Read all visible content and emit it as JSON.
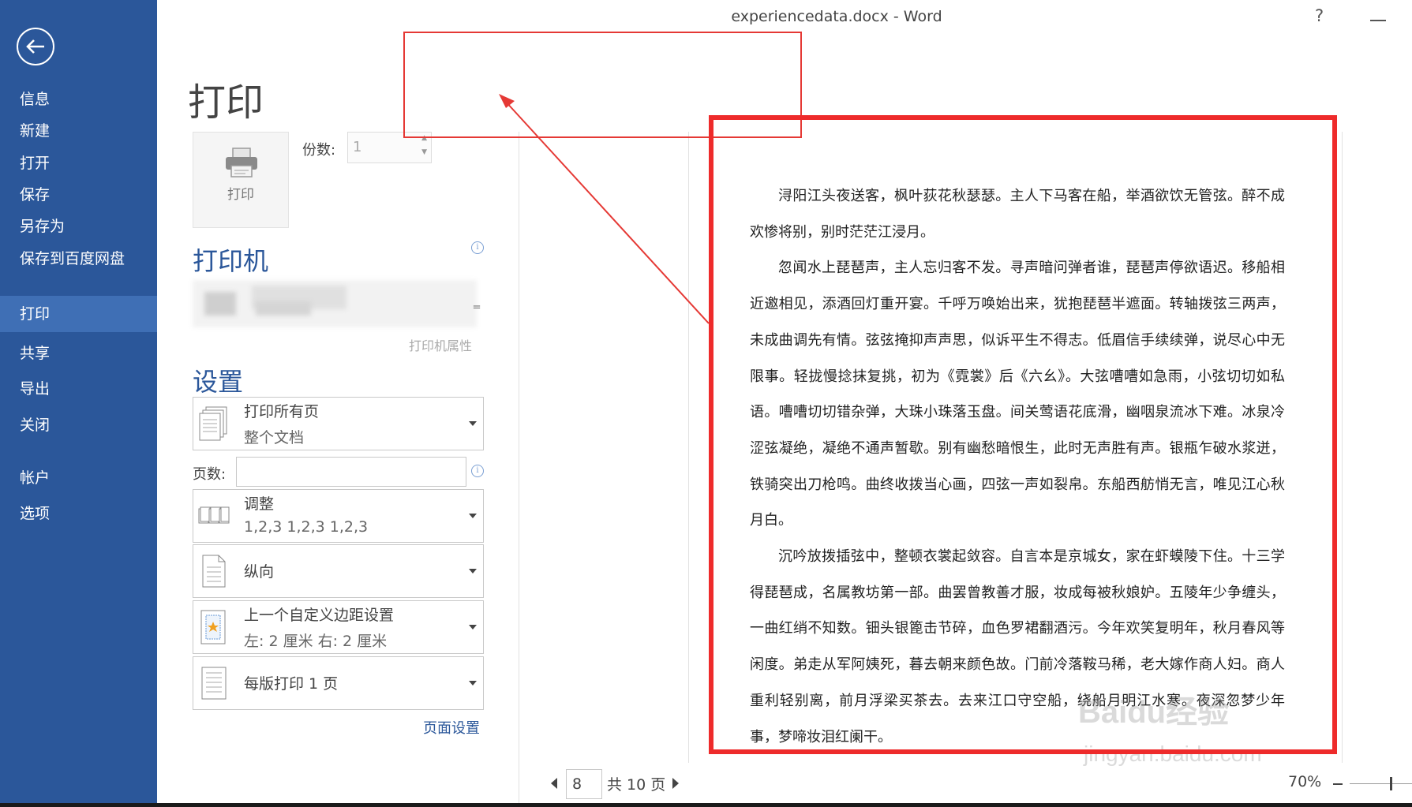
{
  "window": {
    "title": "experiencedata.docx - Word",
    "help_label": "?"
  },
  "sidebar": {
    "items": [
      {
        "label": "信息"
      },
      {
        "label": "新建"
      },
      {
        "label": "打开"
      },
      {
        "label": "保存"
      },
      {
        "label": "另存为"
      },
      {
        "label": "保存到百度网盘"
      },
      {
        "label": "打印",
        "active": true
      },
      {
        "label": "共享"
      },
      {
        "label": "导出"
      },
      {
        "label": "关闭"
      },
      {
        "label": "帐户"
      },
      {
        "label": "选项"
      }
    ]
  },
  "print": {
    "title": "打印",
    "button_label": "打印",
    "copies_label": "份数:",
    "copies_value": "1",
    "printer_heading": "打印机",
    "printer_properties": "打印机属性",
    "settings_heading": "设置",
    "pages_label": "页数:",
    "pages_value": "",
    "page_setup": "页面设置",
    "settings": [
      {
        "line1": "打印所有页",
        "line2": "整个文档",
        "icon": "document-pages-icon"
      },
      {
        "line1": "调整",
        "line2": "1,2,3    1,2,3    1,2,3",
        "icon": "collate-icon"
      },
      {
        "line1": "纵向",
        "line2": "",
        "icon": "portrait-icon"
      },
      {
        "line1": "上一个自定义边距设置",
        "line2": "左:  2 厘米     右:  2 厘米",
        "icon": "margins-icon"
      },
      {
        "line1": "每版打印 1 页",
        "line2": "",
        "icon": "pages-per-sheet-icon"
      }
    ]
  },
  "preview": {
    "paragraphs": [
      "浔阳江头夜送客，枫叶荻花秋瑟瑟。主人下马客在船，举酒欲饮无管弦。醉不成欢惨将别，别时茫茫江浸月。",
      "忽闻水上琵琶声，主人忘归客不发。寻声暗问弹者谁，琵琶声停欲语迟。移船相近邀相见，添酒回灯重开宴。千呼万唤始出来，犹抱琵琶半遮面。转轴拨弦三两声，未成曲调先有情。弦弦掩抑声声思，似诉平生不得志。低眉信手续续弹，说尽心中无限事。轻拢慢捻抹复挑，初为《霓裳》后《六幺》。大弦嘈嘈如急雨，小弦切切如私语。嘈嘈切切错杂弹，大珠小珠落玉盘。间关莺语花底滑，幽咽泉流冰下难。冰泉冷涩弦凝绝，凝绝不通声暂歇。别有幽愁暗恨生，此时无声胜有声。银瓶乍破水浆迸，铁骑突出刀枪鸣。曲终收拨当心画，四弦一声如裂帛。东船西舫悄无言，唯见江心秋月白。",
      "沉吟放拨插弦中，整顿衣裳起敛容。自言本是京城女，家在虾蟆陵下住。十三学得琵琶成，名属教坊第一部。曲罢曾教善才服，妆成每被秋娘妒。五陵年少争缠头，一曲红绡不知数。钿头银篦击节碎，血色罗裙翻酒污。今年欢笑复明年，秋月春风等闲度。弟走从军阿姨死，暮去朝来颜色故。门前冷落鞍马稀，老大嫁作商人妇。商人重利轻别离，前月浮梁买茶去。去来江口守空船，绕船月明江水寒。夜深忽梦少年事，梦啼妆泪红阑干。"
    ],
    "page_number": "8",
    "total_pages": "共 10 页",
    "zoom": "70%",
    "zoom_fraction": 0.65,
    "watermark": "Baidu经验",
    "watermark_url": "jingyan.baidu.com"
  },
  "annotations": {
    "color": "#e53935"
  },
  "colors": {
    "sidebar": "#2b579a",
    "sidebar_active": "#3f6fb5",
    "accent": "#2b579a"
  }
}
